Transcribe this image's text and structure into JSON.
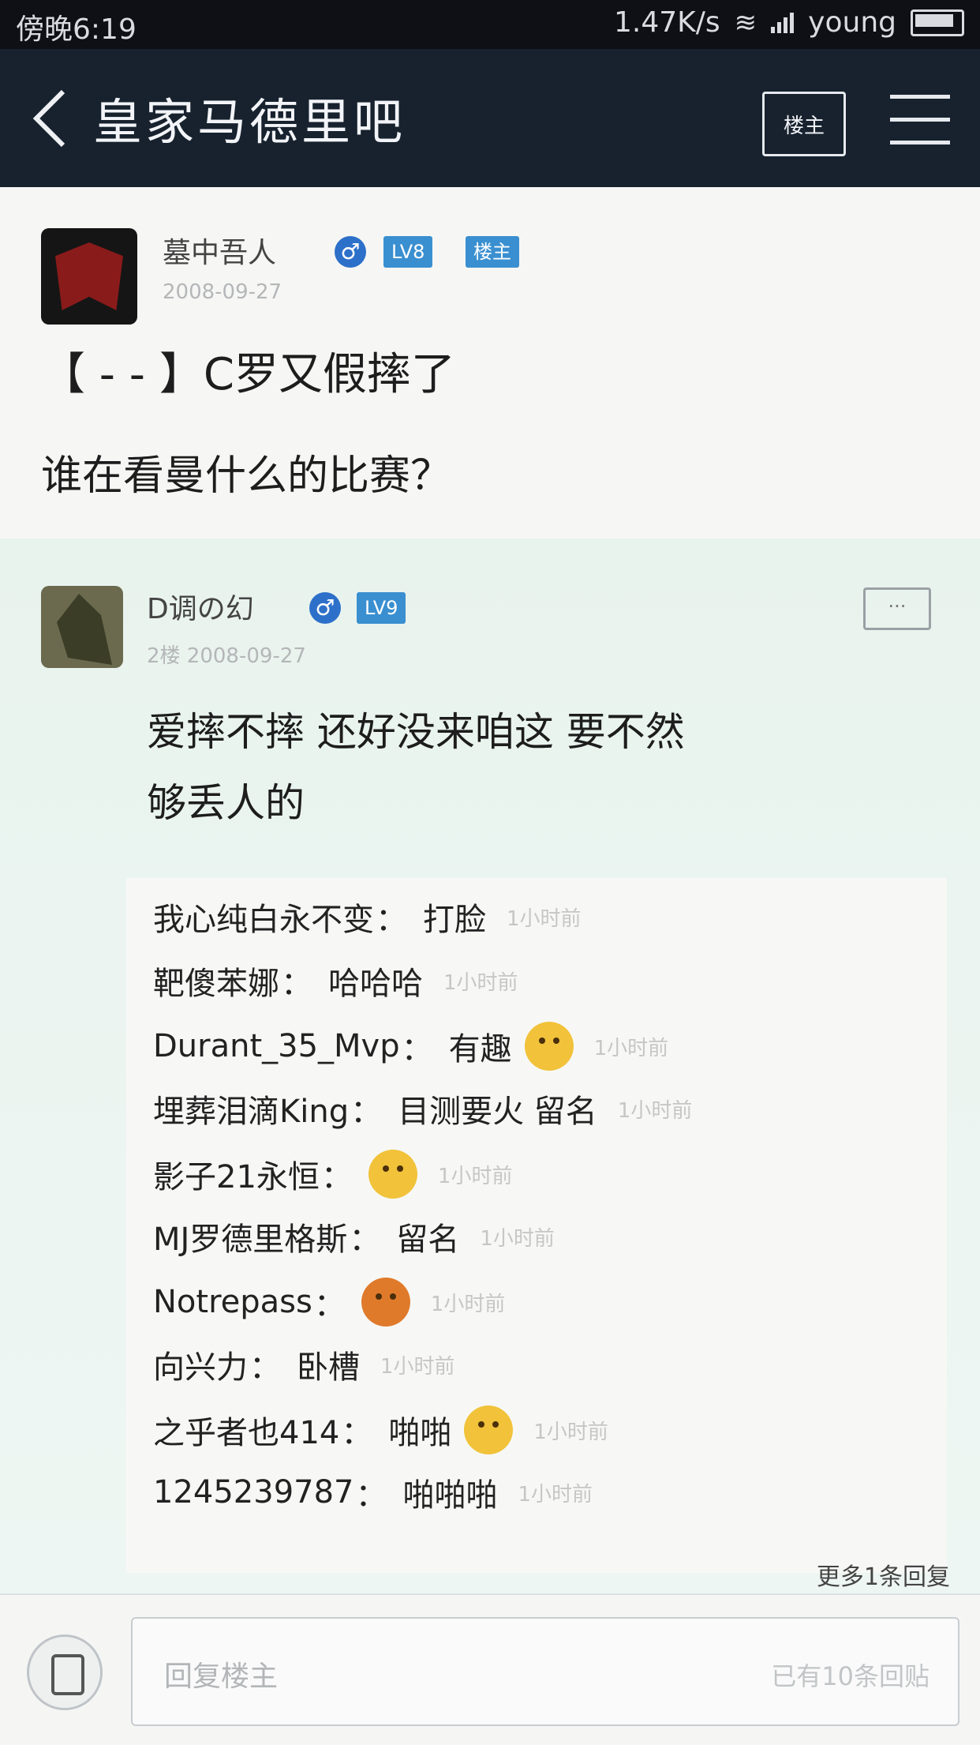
{
  "status_bar": {
    "time": "傍晚6:19",
    "network_speed": "1.47K/s",
    "carrier": "young"
  },
  "nav": {
    "title": "皇家马德里吧",
    "owner_button": "楼主"
  },
  "post": {
    "author": "墓中吾人",
    "gender": "♂",
    "level": "LV8",
    "owner_badge": "楼主",
    "date": "2008-09-27",
    "title": "【 - - 】C罗又假摔了",
    "body": "谁在看曼什么的比赛？"
  },
  "reply": {
    "author": "D调の幻",
    "gender": "♂",
    "level": "LV9",
    "meta": "2楼 2008-09-27",
    "comment_icon": "···",
    "body_line1": "爱摔不摔 还好没来咱这 要不然",
    "body_line2": "够丢人的",
    "sub_replies": [
      {
        "name": "我心纯白永不变",
        "text": "打脸",
        "emoji": "",
        "time": "1小时前"
      },
      {
        "name": "靶傻苯娜",
        "text": "哈哈哈",
        "emoji": "",
        "time": "1小时前"
      },
      {
        "name": "Durant_35_Mvp",
        "text": "有趣",
        "emoji": "emoji-yellow",
        "time": "1小时前"
      },
      {
        "name": "埋葬泪滴King",
        "text": "目测要火 留名",
        "emoji": "",
        "time": "1小时前"
      },
      {
        "name": "影子21永恒",
        "text": "",
        "emoji": "emoji-yellow",
        "time": "1小时前"
      },
      {
        "name": "MJ罗德里格斯",
        "text": "留名",
        "emoji": "",
        "time": "1小时前"
      },
      {
        "name": "Notrepass",
        "text": "",
        "emoji": "emoji-orange",
        "time": "1小时前"
      },
      {
        "name": "向兴力",
        "text": "卧槽",
        "emoji": "",
        "time": "1小时前"
      },
      {
        "name": "之乎者也414",
        "text": "啪啪",
        "emoji": "emoji-yellow",
        "time": "1小时前"
      },
      {
        "name": "1245239787",
        "text": "啪啪啪",
        "emoji": "",
        "time": "1小时前"
      }
    ],
    "more_replies": "更多1条回复"
  },
  "bottom": {
    "placeholder": "回复楼主",
    "reply_count": "已有10条回贴"
  }
}
